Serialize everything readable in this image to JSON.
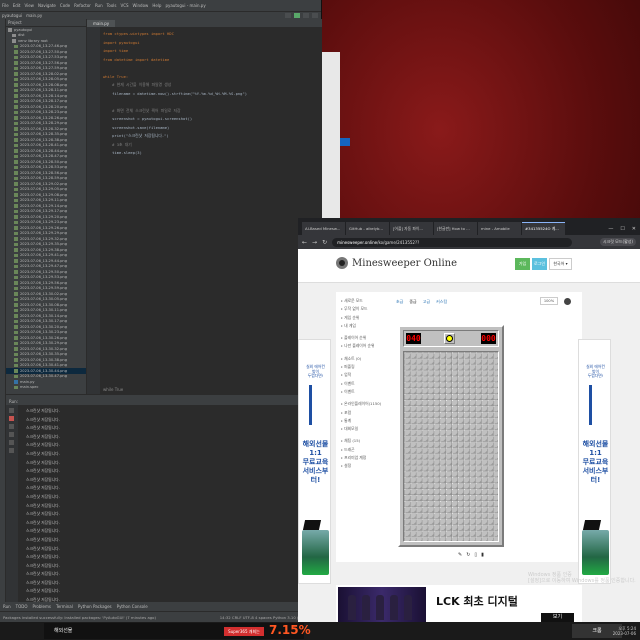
{
  "ide": {
    "menu": [
      "File",
      "Edit",
      "View",
      "Navigate",
      "Code",
      "Refactor",
      "Run",
      "Tools",
      "VCS",
      "Window",
      "Help",
      "pyautogui - main.py"
    ],
    "breadcrumb": [
      "pyautogui",
      "main.py"
    ],
    "run_config": "main",
    "project_header": "Project",
    "project_tree": [
      {
        "label": "pyautogui",
        "kind": "root"
      },
      {
        "label": "dist",
        "kind": "folder"
      },
      {
        "label": "venv  library root",
        "kind": "folder"
      },
      {
        "label": "2023-07-06_13-27-46.png",
        "kind": "file"
      },
      {
        "label": "2023-07-06_13-27-50.png",
        "kind": "file"
      },
      {
        "label": "2023-07-06_13-27-53.png",
        "kind": "file"
      },
      {
        "label": "2023-07-06_13-27-56.png",
        "kind": "file"
      },
      {
        "label": "2023-07-06_13-27-59.png",
        "kind": "file"
      },
      {
        "label": "2023-07-06_13-28-02.png",
        "kind": "file"
      },
      {
        "label": "2023-07-06_13-28-05.png",
        "kind": "file"
      },
      {
        "label": "2023-07-06_13-28-08.png",
        "kind": "file"
      },
      {
        "label": "2023-07-06_13-28-11.png",
        "kind": "file"
      },
      {
        "label": "2023-07-06_13-28-14.png",
        "kind": "file"
      },
      {
        "label": "2023-07-06_13-28-17.png",
        "kind": "file"
      },
      {
        "label": "2023-07-06_13-28-20.png",
        "kind": "file"
      },
      {
        "label": "2023-07-06_13-28-23.png",
        "kind": "file"
      },
      {
        "label": "2023-07-06_13-28-26.png",
        "kind": "file"
      },
      {
        "label": "2023-07-06_13-28-29.png",
        "kind": "file"
      },
      {
        "label": "2023-07-06_13-28-32.png",
        "kind": "file"
      },
      {
        "label": "2023-07-06_13-28-35.png",
        "kind": "file"
      },
      {
        "label": "2023-07-06_13-28-38.png",
        "kind": "file"
      },
      {
        "label": "2023-07-06_13-28-41.png",
        "kind": "file"
      },
      {
        "label": "2023-07-06_13-28-44.png",
        "kind": "file"
      },
      {
        "label": "2023-07-06_13-28-47.png",
        "kind": "file"
      },
      {
        "label": "2023-07-06_13-28-50.png",
        "kind": "file"
      },
      {
        "label": "2023-07-06_13-28-53.png",
        "kind": "file"
      },
      {
        "label": "2023-07-06_13-28-56.png",
        "kind": "file"
      },
      {
        "label": "2023-07-06_13-28-59.png",
        "kind": "file"
      },
      {
        "label": "2023-07-06_13-29-02.png",
        "kind": "file"
      },
      {
        "label": "2023-07-06_13-29-05.png",
        "kind": "file"
      },
      {
        "label": "2023-07-06_13-29-08.png",
        "kind": "file"
      },
      {
        "label": "2023-07-06_13-29-11.png",
        "kind": "file"
      },
      {
        "label": "2023-07-06_13-29-14.png",
        "kind": "file"
      },
      {
        "label": "2023-07-06_13-29-17.png",
        "kind": "file"
      },
      {
        "label": "2023-07-06_13-29-20.png",
        "kind": "file"
      },
      {
        "label": "2023-07-06_13-29-23.png",
        "kind": "file"
      },
      {
        "label": "2023-07-06_13-29-26.png",
        "kind": "file"
      },
      {
        "label": "2023-07-06_13-29-29.png",
        "kind": "file"
      },
      {
        "label": "2023-07-06_13-29-32.png",
        "kind": "file"
      },
      {
        "label": "2023-07-06_13-29-35.png",
        "kind": "file"
      },
      {
        "label": "2023-07-06_13-29-38.png",
        "kind": "file"
      },
      {
        "label": "2023-07-06_13-29-41.png",
        "kind": "file"
      },
      {
        "label": "2023-07-06_13-29-44.png",
        "kind": "file"
      },
      {
        "label": "2023-07-06_13-29-47.png",
        "kind": "file"
      },
      {
        "label": "2023-07-06_13-29-50.png",
        "kind": "file"
      },
      {
        "label": "2023-07-06_13-29-53.png",
        "kind": "file"
      },
      {
        "label": "2023-07-06_13-29-56.png",
        "kind": "file"
      },
      {
        "label": "2023-07-06_13-29-59.png",
        "kind": "file"
      },
      {
        "label": "2023-07-06_13-30-02.png",
        "kind": "file"
      },
      {
        "label": "2023-07-06_13-30-05.png",
        "kind": "file"
      },
      {
        "label": "2023-07-06_13-30-08.png",
        "kind": "file"
      },
      {
        "label": "2023-07-06_13-30-11.png",
        "kind": "file"
      },
      {
        "label": "2023-07-06_13-30-14.png",
        "kind": "file"
      },
      {
        "label": "2023-07-06_13-30-17.png",
        "kind": "file"
      },
      {
        "label": "2023-07-06_13-30-20.png",
        "kind": "file"
      },
      {
        "label": "2023-07-06_13-30-23.png",
        "kind": "file"
      },
      {
        "label": "2023-07-06_13-30-26.png",
        "kind": "file"
      },
      {
        "label": "2023-07-06_13-30-29.png",
        "kind": "file"
      },
      {
        "label": "2023-07-06_13-30-32.png",
        "kind": "file"
      },
      {
        "label": "2023-07-06_13-30-35.png",
        "kind": "file"
      },
      {
        "label": "2023-07-06_13-30-38.png",
        "kind": "file"
      },
      {
        "label": "2023-07-06_13-30-41.png",
        "kind": "file"
      },
      {
        "label": "2023-07-06_13-30-44.png",
        "kind": "file",
        "selected": true
      },
      {
        "label": "2023-07-06_13-30-47.png",
        "kind": "file"
      },
      {
        "label": "main.py",
        "kind": "py"
      },
      {
        "label": "main.spec",
        "kind": "file"
      }
    ],
    "editor_tab": "main.py",
    "code_lines": [
      "from ctypes.wintypes import HDC",
      "import pyautogui",
      "import time",
      "from datetime import datetime",
      "",
      "while True:",
      "    # 현재 시간을 이용해 파일명 생성",
      "    filename = datetime.now().strftime(\"%Y-%m-%d_%H-%M-%S.png\")",
      "",
      "    # 화면 전체 스크린샷 찍어 파일로 저장",
      "    screenshot = pyautogui.screenshot()",
      "    screenshot.save(filename)",
      "    print(\"스크린샷 저장됨니다.\")",
      "    # 3초 대기",
      "    time.sleep(3)"
    ],
    "editor_crumb": "while True",
    "run_header": "Run:",
    "run_output": [
      "스크린샷 저장됨니다.",
      "스크린샷 저장됨니다.",
      "스크린샷 저장됨니다.",
      "스크린샷 저장됨니다.",
      "스크린샷 저장됨니다.",
      "스크린샷 저장됨니다.",
      "스크린샷 저장됨니다.",
      "스크린샷 저장됨니다.",
      "스크린샷 저장됨니다.",
      "스크린샷 저장됨니다.",
      "스크린샷 저장됨니다.",
      "스크린샷 저장됨니다.",
      "스크린샷 저장됨니다.",
      "스크린샷 저장됨니다.",
      "스크린샷 저장됨니다.",
      "스크린샷 저장됨니다.",
      "스크린샷 저장됨니다.",
      "스크린샷 저장됨니다.",
      "스크린샷 저장됨니다.",
      "스크린샷 저장됨니다.",
      "스크린샷 저장됨니다.",
      "스크린샷 저장됨니다.",
      "스크린샷 저장됨니다."
    ],
    "bottom_tabs": [
      "Run",
      "TODO",
      "Problems",
      "Terminal",
      "Python Packages",
      "Python Console"
    ],
    "status_left": "Packages installed successfully: Installed packages: 'PyAutoGUI' (7 minutes ago)",
    "status_right": "14:32  CRLF  UTF-8  4 spaces  Python 3.10 (pyautogui)"
  },
  "browser": {
    "tabs": [
      "AI-Based Minesw...",
      "GitHub - aikelyb...",
      "[어플] 자동 파이...",
      "[한글판] How to ...",
      "mine - Amobile",
      "#34135524O 게..."
    ],
    "active_tab_index": 5,
    "window_controls": [
      "—",
      "☐",
      "✕"
    ],
    "url_host": "minesweeper.online",
    "url_path": "/ko/game/2413552??",
    "profile": "시크릿 모드(활성)",
    "site": {
      "logo": "Minesweeper Online",
      "btn_green": "가입",
      "btn_blue": "로그인",
      "lang": "한국어 ▾",
      "left_menu": [
        "새로운 모드",
        "무작 없이 모드",
        "게임 순위",
        "내 게임",
        "",
        "플레이어 순위",
        "나만 플레이어 순위",
        "",
        "채소트 (0)",
        "퍼즐링",
        "업적",
        "이벤트",
        "이벤트",
        "",
        "온라인플레이어(1150)",
        "포럼",
        "통계",
        "대회모일",
        "",
        "채팅 (15)",
        "드래곤",
        "프리미엄 계정",
        "설정"
      ],
      "game_tabs": [
        "초급",
        "중급",
        "고급",
        "커스텀"
      ],
      "active_game_tab": 1,
      "zoom": "100%",
      "mine_counter": "040",
      "timer": "000",
      "board": {
        "rows": 32,
        "cols": 16
      },
      "board_tools": [
        "✎",
        "↻",
        "▯",
        "▮"
      ],
      "ad_title": "실외 에어컨\n밖이\n두렵다면!",
      "ad_big": "해외선물\n1:1\n무료교육\n서비스부터!",
      "banner_text": "LCK 최초 디지털",
      "banner_btn": "보기"
    }
  },
  "desktop": {
    "activate_windows": "Windows 정품 인증\n[설정]으로 이동하여 Windows를 정품 인증합니다."
  },
  "taskbar": {
    "promo_text": "해외선물",
    "promo_badge": "Super365 개최는",
    "promo_big": "7.15%",
    "chrome_label": "크롬",
    "clock": "오후 5:24\n2023-07-06"
  }
}
